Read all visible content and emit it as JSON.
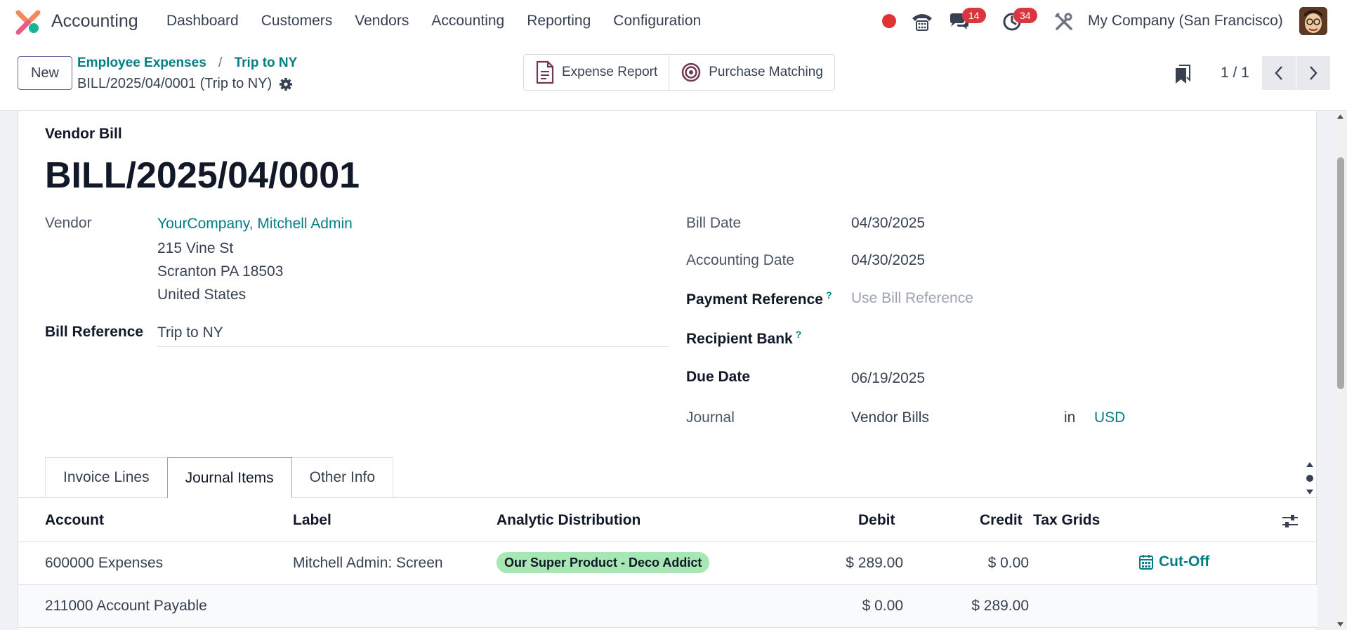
{
  "navbar": {
    "app_name": "Accounting",
    "menu": [
      "Dashboard",
      "Customers",
      "Vendors",
      "Accounting",
      "Reporting",
      "Configuration"
    ],
    "messages_count": "14",
    "activities_count": "34",
    "company": "My Company (San Francisco)"
  },
  "control": {
    "new_label": "New",
    "breadcrumbs": [
      "Employee Expenses",
      "Trip to NY"
    ],
    "breadcrumb_sep": "/",
    "record_name": "BILL/2025/04/0001 (Trip to NY)",
    "smart_buttons": [
      "Expense Report",
      "Purchase Matching"
    ],
    "pager": "1 / 1"
  },
  "form": {
    "type_label": "Vendor Bill",
    "number": "BILL/2025/04/0001",
    "vendor_label": "Vendor",
    "vendor_name": "YourCompany, Mitchell Admin",
    "vendor_address": [
      "215 Vine St",
      "Scranton PA 18503",
      "United States"
    ],
    "bill_ref_label": "Bill Reference",
    "bill_ref_value": "Trip to NY",
    "bill_date_label": "Bill Date",
    "bill_date": "04/30/2025",
    "accounting_date_label": "Accounting Date",
    "accounting_date": "04/30/2025",
    "payment_ref_label": "Payment Reference",
    "payment_ref_placeholder": "Use Bill Reference",
    "recipient_bank_label": "Recipient Bank",
    "help_mark": "?",
    "due_date_label": "Due Date",
    "due_date": "06/19/2025",
    "journal_label": "Journal",
    "journal_value": "Vendor Bills",
    "journal_in": "in",
    "currency": "USD"
  },
  "tabs": [
    "Invoice Lines",
    "Journal Items",
    "Other Info"
  ],
  "table": {
    "headers": [
      "Account",
      "Label",
      "Analytic Distribution",
      "Debit",
      "Credit",
      "Tax Grids"
    ],
    "rows": [
      {
        "account": "600000 Expenses",
        "label": "Mitchell Admin: Screen",
        "analytic": "Our Super Product - Deco Addict",
        "debit": "$ 289.00",
        "credit": "$ 0.00",
        "action": "Cut-Off"
      },
      {
        "account": "211000 Account Payable",
        "label": "",
        "analytic": "",
        "debit": "$ 0.00",
        "credit": "$ 289.00",
        "action": ""
      }
    ]
  },
  "colors": {
    "accent": "#017e84",
    "brand": "#71639e",
    "badge": "#d9363e",
    "tag": "#a8e6b4"
  }
}
